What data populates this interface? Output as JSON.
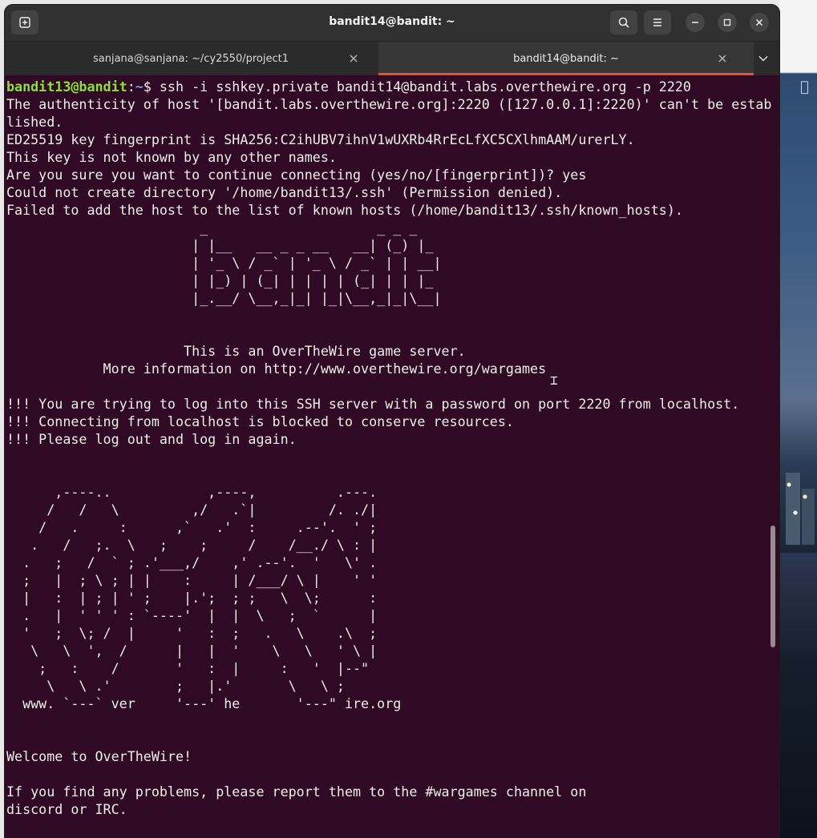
{
  "window": {
    "title": "bandit14@bandit: ~"
  },
  "tabs": [
    {
      "label": "sanjana@sanjana: ~/cy2550/project1",
      "active": false
    },
    {
      "label": "bandit14@bandit: ~",
      "active": true
    }
  ],
  "icons": {
    "new_tab": "new-tab-icon",
    "search": "search-icon",
    "menu": "hamburger-menu-icon",
    "minimize": "minimize-icon",
    "maximize": "maximize-icon",
    "close": "close-icon",
    "tab_close": "close-icon",
    "tab_dropdown": "chevron-down-icon"
  },
  "colors": {
    "terminal_bg": "#300a24",
    "prompt_user": "#8ae234",
    "prompt_path": "#729fcf",
    "active_tab_accent": "#e95420"
  },
  "terminal": {
    "prompt": {
      "user_host": "bandit13@bandit",
      "separator": ":",
      "path": "~",
      "symbol": "$ ",
      "command": "ssh -i sshkey.private bandit14@bandit.labs.overthewire.org -p 2220"
    },
    "output": "The authenticity of host '[bandit.labs.overthewire.org]:2220 ([127.0.0.1]:2220)' can't be estab\nlished.\nED25519 key fingerprint is SHA256:C2ihUBV7ihnV1wUXRb4RrEcLfXC5CXlhmAAM/urerLY.\nThis key is not known by any other names.\nAre you sure you want to continue connecting (yes/no/[fingerprint])? yes\nCould not create directory '/home/bandit13/.ssh' (Permission denied).\nFailed to add the host to the list of known hosts (/home/bandit13/.ssh/known_hosts).\n                        _                     _ _ _\n                       | |__   __ _ _ __   __| (_) |_\n                       | '_ \\ / _` | '_ \\ / _` | | __|\n                       | |_) | (_| | | | | (_| | | |_\n                       |_.__/ \\__,_|_| |_|\\__,_|_|\\__|\n\n\n                      This is an OverTheWire game server.\n            More information on http://www.overthewire.org/wargames\n\n!!! You are trying to log into this SSH server with a password on port 2220 from localhost.\n!!! Connecting from localhost is blocked to conserve resources.\n!!! Please log out and log in again.\n\n\n      ,----..            ,----,          .---.\n     /   /   \\         ,/   .`|         /. ./|\n    /   .     :      ,`   .'  :     .--'.  ' ;\n   .   /   ;.  \\   ;    ;     /    /__./ \\ : |\n  .   ;   /  ` ; .'___,/    ,' .--'.  '   \\' .\n  ;   |  ; \\ ; | |    :     | /___/ \\ |    ' '\n  |   :  | ; | ' ;    |.';  ; ;   \\  \\;      :\n  .   |  ' ' ' : `----'  |  |  \\   ;  `      |\n  '   ;  \\; /  |     '   :  ;   .   \\    .\\  ;\n   \\   \\  ',  /      |   |  '    \\   \\   ' \\ |\n    ;   :    /       '   :  |     :   '  |--\"\n     \\   \\ .'        ;   |.'       \\   \\ ;\n  www. `---` ver     '---' he       '---\" ire.org\n\n\nWelcome to OverTheWire!\n\nIf you find any problems, please report them to the #wargames channel on\ndiscord or IRC."
  }
}
